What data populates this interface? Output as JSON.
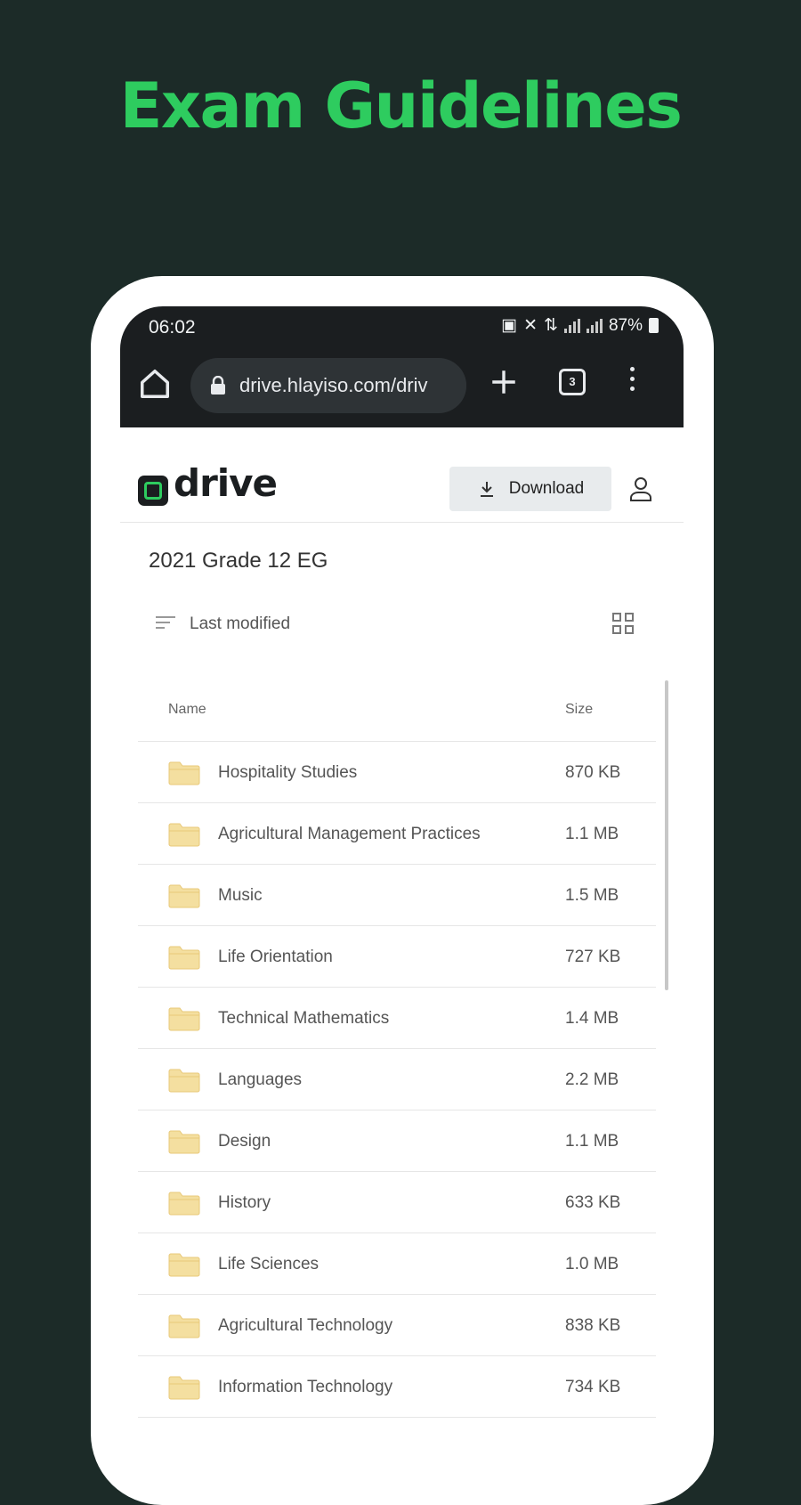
{
  "promo": {
    "title": "Exam Guidelines"
  },
  "status_bar": {
    "time": "06:02",
    "battery": "87%"
  },
  "browser": {
    "url": "drive.hlayiso.com/driv",
    "tab_count": "3"
  },
  "site": {
    "logo_text": "drive",
    "download_label": "Download"
  },
  "folder": {
    "title": "2021 Grade 12 EG",
    "sort_label": "Last modified"
  },
  "table": {
    "headers": {
      "name": "Name",
      "size": "Size"
    },
    "rows": [
      {
        "name": "Hospitality Studies",
        "size": "870 KB"
      },
      {
        "name": "Agricultural Management Practices",
        "size": "1.1 MB"
      },
      {
        "name": "Music",
        "size": "1.5 MB"
      },
      {
        "name": "Life Orientation",
        "size": "727 KB"
      },
      {
        "name": "Technical Mathematics",
        "size": "1.4 MB"
      },
      {
        "name": "Languages",
        "size": "2.2 MB"
      },
      {
        "name": "Design",
        "size": "1.1 MB"
      },
      {
        "name": "History",
        "size": "633 KB"
      },
      {
        "name": "Life Sciences",
        "size": "1.0 MB"
      },
      {
        "name": "Agricultural Technology",
        "size": "838 KB"
      },
      {
        "name": "Information Technology",
        "size": "734 KB"
      }
    ]
  },
  "colors": {
    "background": "#1c2b28",
    "accent": "#2ecc5f",
    "folder": "#f4dfa0"
  },
  "icons": [
    "home-icon",
    "lock-icon",
    "plus-icon",
    "tabs-icon",
    "menu-icon",
    "download-icon",
    "user-icon",
    "sort-icon",
    "grid-view-icon",
    "folder-icon"
  ]
}
